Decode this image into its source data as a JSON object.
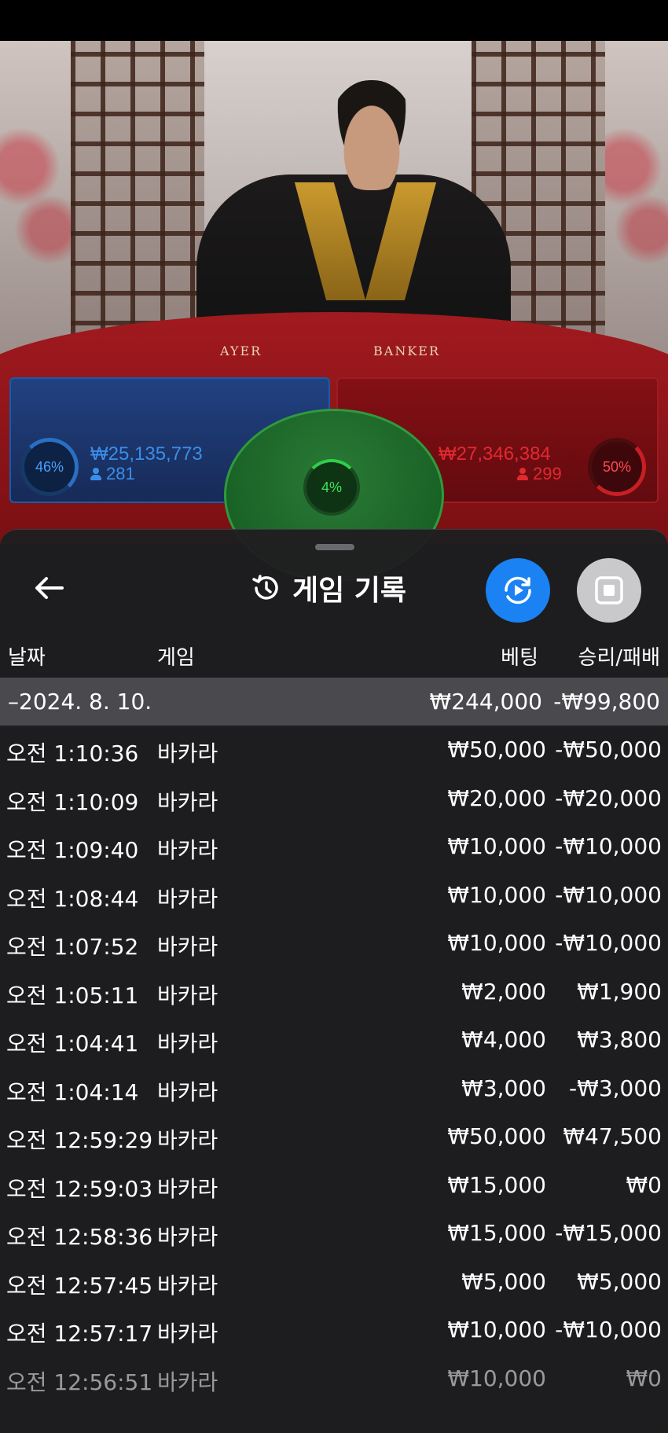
{
  "video": {
    "table_labels": {
      "player": "AYER",
      "banker": "BANKER"
    },
    "player": {
      "percent": "46%",
      "amount": "₩25,135,773",
      "players": "281",
      "percent_value": 46
    },
    "tie": {
      "percent": "4%",
      "percent_value": 4
    },
    "banker": {
      "percent": "50%",
      "amount": "₩27,346,384",
      "players": "299",
      "percent_value": 50
    }
  },
  "sheet": {
    "title": "게임 기록",
    "icons": {
      "back": "arrow-left-icon",
      "history": "history-clock-icon",
      "play": "video-replay-icon",
      "stop": "stop-icon"
    },
    "colors": {
      "play_button": "#1a82f2",
      "stop_button": "#c9c9cc",
      "date_row": "#4a4a4e"
    },
    "headers": {
      "date": "날짜",
      "game": "게임",
      "bet": "베팅",
      "result": "승리/패배"
    },
    "date_group": {
      "date": "–2024. 8. 10.",
      "bet": "₩244,000",
      "result": "-₩99,800"
    },
    "rows": [
      {
        "time": "오전 1:10:36",
        "game": "바카라",
        "bet": "₩50,000",
        "result": "-₩50,000"
      },
      {
        "time": "오전 1:10:09",
        "game": "바카라",
        "bet": "₩20,000",
        "result": "-₩20,000"
      },
      {
        "time": "오전 1:09:40",
        "game": "바카라",
        "bet": "₩10,000",
        "result": "-₩10,000"
      },
      {
        "time": "오전 1:08:44",
        "game": "바카라",
        "bet": "₩10,000",
        "result": "-₩10,000"
      },
      {
        "time": "오전 1:07:52",
        "game": "바카라",
        "bet": "₩10,000",
        "result": "-₩10,000"
      },
      {
        "time": "오전 1:05:11",
        "game": "바카라",
        "bet": "₩2,000",
        "result": "₩1,900"
      },
      {
        "time": "오전 1:04:41",
        "game": "바카라",
        "bet": "₩4,000",
        "result": "₩3,800"
      },
      {
        "time": "오전 1:04:14",
        "game": "바카라",
        "bet": "₩3,000",
        "result": "-₩3,000"
      },
      {
        "time": "오전 12:59:29",
        "game": "바카라",
        "bet": "₩50,000",
        "result": "₩47,500"
      },
      {
        "time": "오전 12:59:03",
        "game": "바카라",
        "bet": "₩15,000",
        "result": "₩0"
      },
      {
        "time": "오전 12:58:36",
        "game": "바카라",
        "bet": "₩15,000",
        "result": "-₩15,000"
      },
      {
        "time": "오전 12:57:45",
        "game": "바카라",
        "bet": "₩5,000",
        "result": "₩5,000"
      },
      {
        "time": "오전 12:57:17",
        "game": "바카라",
        "bet": "₩10,000",
        "result": "-₩10,000"
      },
      {
        "time": "오전 12:56:51",
        "game": "바카라",
        "bet": "₩10,000",
        "result": "₩0"
      }
    ]
  }
}
